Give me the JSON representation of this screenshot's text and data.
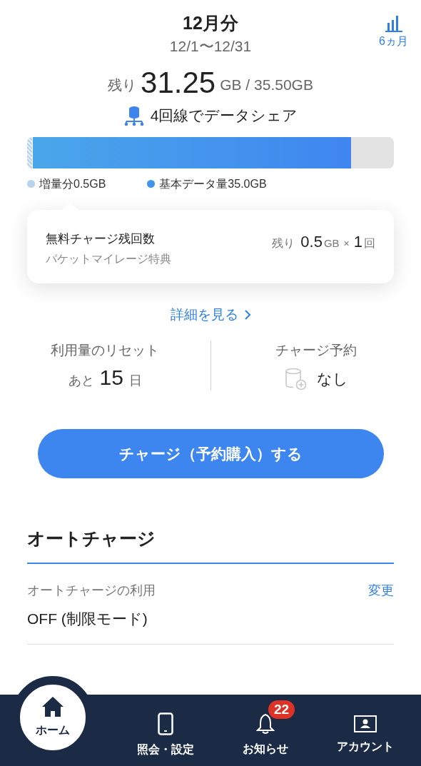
{
  "header": {
    "title": "12月分",
    "period": "12/1〜12/31",
    "history_button": "6ヵ月"
  },
  "remaining": {
    "prefix": "残り",
    "value": "31.25",
    "unit": "GB / 35.50GB"
  },
  "share": {
    "label": "4回線でデータシェア"
  },
  "usage_bar": {
    "segments": [
      {
        "kind": "bonus",
        "label": "増量分0.5GB",
        "color": "#b7d3ef"
      },
      {
        "kind": "base",
        "label": "基本データ量35.0GB",
        "color": "#4295ea"
      }
    ]
  },
  "free_charge": {
    "title": "無料チャージ残回数",
    "subtitle": "パケットマイレージ特典",
    "prefix": "残り",
    "amount": "0.5",
    "unit": "GB",
    "times_sign": "×",
    "count": "1",
    "count_unit": "回"
  },
  "details_link": "詳細を見る",
  "stats": [
    {
      "kind": "countdown",
      "label": "利用量のリセット",
      "prefix": "あと",
      "value": "15",
      "suffix": "日"
    },
    {
      "kind": "reservation",
      "label": "チャージ予約",
      "value": "なし"
    }
  ],
  "charge_button": "チャージ（予約購入）する",
  "auto_charge": {
    "title": "オートチャージ",
    "setting_label": "オートチャージの利用",
    "change_link": "変更",
    "setting_value": "OFF (制限モード)"
  },
  "nav": [
    {
      "kind": "home",
      "label": "ホーム",
      "selected": true
    },
    {
      "kind": "phone",
      "label": "照会・設定",
      "selected": false
    },
    {
      "kind": "bell",
      "label": "お知らせ",
      "selected": false,
      "badge": "22"
    },
    {
      "kind": "account",
      "label": "アカウント",
      "selected": false
    }
  ]
}
